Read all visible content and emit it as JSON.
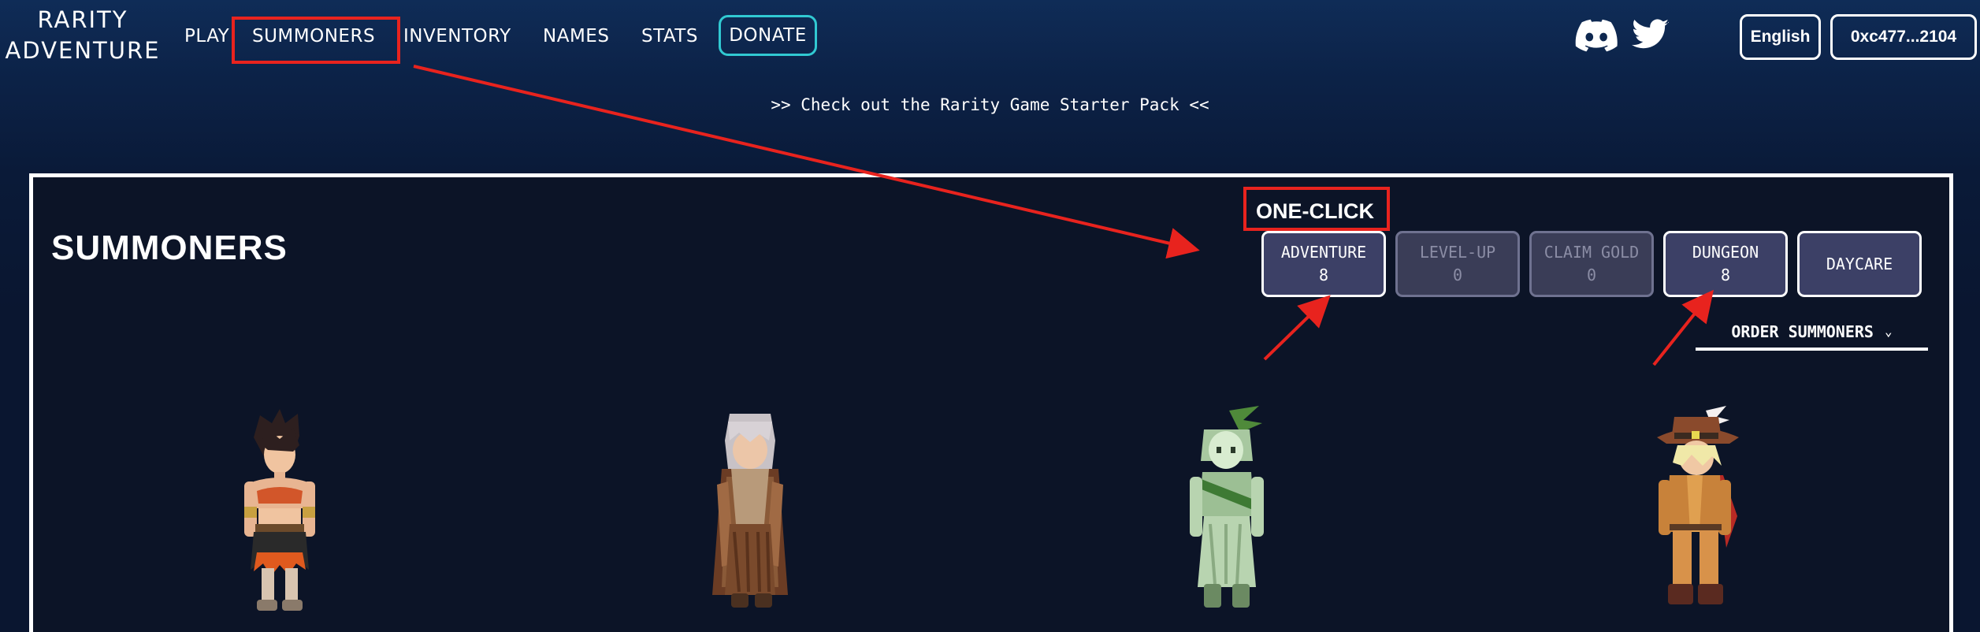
{
  "brand": {
    "line1": "RARITY",
    "line2": "ADVENTURE"
  },
  "nav": {
    "play": "PLAY",
    "summoners": "SUMMONERS",
    "inventory": "INVENTORY",
    "names": "NAMES",
    "stats": "STATS",
    "donate": "DONATE"
  },
  "social": {
    "discord_icon": "discord-icon",
    "twitter_icon": "twitter-icon"
  },
  "header_buttons": {
    "language": "English",
    "wallet": "0xc477...2104"
  },
  "banner": {
    "text": ">> Check out the Rarity Game Starter Pack <<"
  },
  "panel": {
    "title": "SUMMONERS",
    "one_click_label": "ONE-CLICK",
    "actions": [
      {
        "label": "ADVENTURE",
        "count": "8",
        "enabled": true
      },
      {
        "label": "LEVEL-UP",
        "count": "0",
        "enabled": false
      },
      {
        "label": "CLAIM GOLD",
        "count": "0",
        "enabled": false
      },
      {
        "label": "DUNGEON",
        "count": "8",
        "enabled": true
      },
      {
        "label": "DAYCARE",
        "count": "",
        "enabled": true
      }
    ],
    "order_label": "ORDER SUMMONERS"
  },
  "summoners": [
    {
      "name": "barbarian-sprite"
    },
    {
      "name": "monk-sprite"
    },
    {
      "name": "druid-sprite"
    },
    {
      "name": "bard-sprite"
    }
  ],
  "colors": {
    "background": "#0c2247",
    "panel": "#0c1427",
    "donate_border": "#31c9d2",
    "annotation_red": "#e8231e",
    "action_enabled": "#3c4066",
    "action_disabled": "#3a3d57"
  }
}
